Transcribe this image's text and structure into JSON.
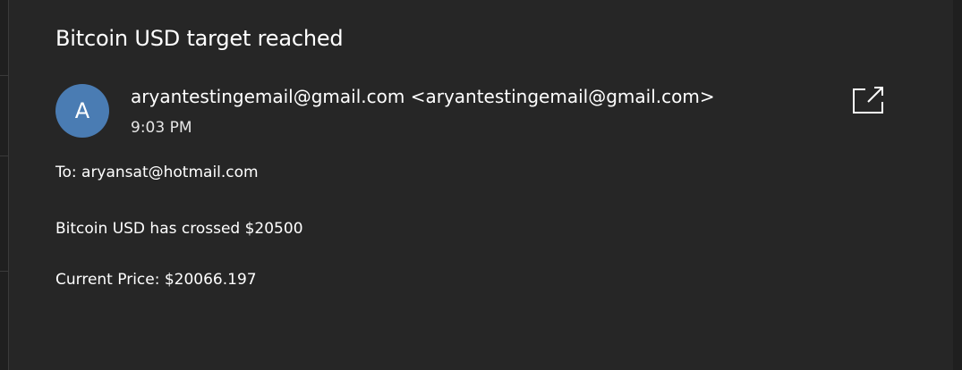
{
  "email": {
    "subject": "Bitcoin USD target reached",
    "avatar_letter": "A",
    "sender": "aryantestingemail@gmail.com <aryantestingemail@gmail.com>",
    "time": "9:03 PM",
    "to_line": "To: aryansat@hotmail.com",
    "body_lines": [
      "Bitcoin USD has crossed $20500",
      "Current Price: $20066.197"
    ]
  },
  "icons": {
    "popout": "open-in-new-window-icon"
  },
  "colors": {
    "background": "#262626",
    "avatar": "#4a7cb3",
    "text": "#ffffff"
  }
}
